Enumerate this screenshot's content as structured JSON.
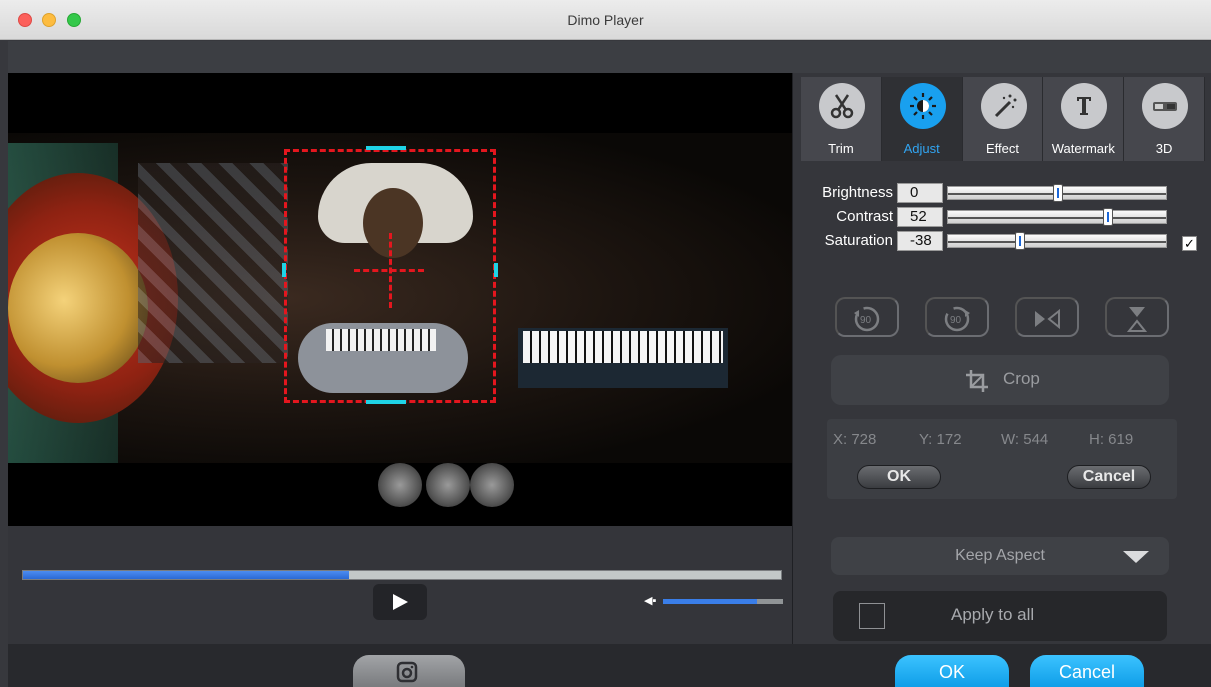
{
  "window": {
    "title": "Dimo Player"
  },
  "tabs": [
    {
      "label": "Trim",
      "icon": "scissors-icon"
    },
    {
      "label": "Adjust",
      "icon": "brightness-icon",
      "active": true
    },
    {
      "label": "Effect",
      "icon": "magic-wand-icon"
    },
    {
      "label": "Watermark",
      "icon": "text-watermark-icon"
    },
    {
      "label": "3D",
      "icon": "3d-glasses-icon"
    }
  ],
  "adjust": {
    "brightness": {
      "label": "Brightness",
      "value": "0",
      "level": 0.5
    },
    "contrast": {
      "label": "Contrast",
      "value": "52",
      "level": 0.74
    },
    "saturation": {
      "label": "Saturation",
      "value": "-38",
      "level": 0.32
    },
    "checkbox_checked": true,
    "checkmark": "✓"
  },
  "crop": {
    "label": "Crop",
    "x": "X: 728",
    "y": "Y: 172",
    "w": "W: 544",
    "h": "H: 619",
    "ok_label": "OK",
    "cancel_label": "Cancel",
    "aspect": "Keep Aspect",
    "apply_label": "Apply to all"
  },
  "player": {
    "progress": 0.43,
    "volume": 0.78,
    "volume_glyph": "◀▪"
  },
  "footer": {
    "ok_label": "OK",
    "cancel_label": "Cancel"
  },
  "colors": {
    "accent": "#19a0ef",
    "crop_frame": "#e4161e",
    "crop_handle": "#1fd3e6"
  }
}
